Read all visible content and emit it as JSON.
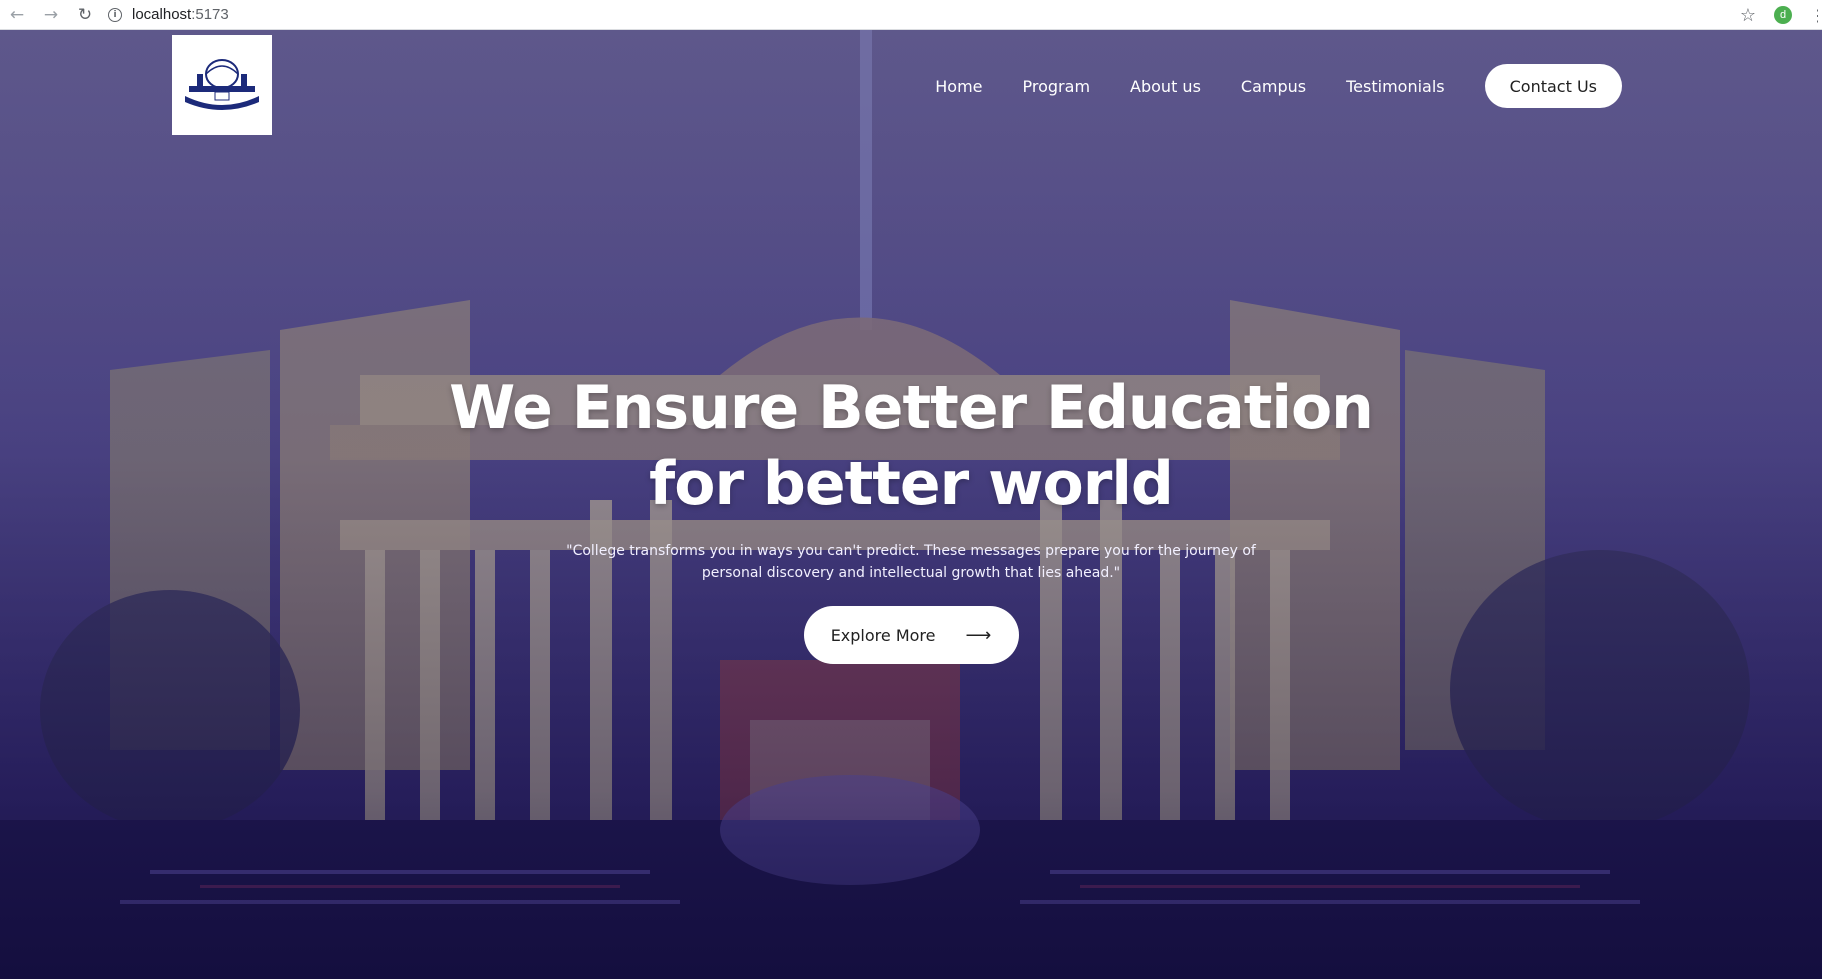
{
  "browser": {
    "url_host": "localhost",
    "url_port": ":5173",
    "profile_initial": "d",
    "icons": {
      "back": "back-arrow-icon",
      "forward": "forward-arrow-icon",
      "reload": "reload-icon",
      "info": "info-icon",
      "star": "star-icon",
      "menu": "menu-icon"
    }
  },
  "navbar": {
    "logo_alt": "College logo",
    "links": [
      "Home",
      "Program",
      "About us",
      "Campus",
      "Testimonials"
    ],
    "contact_label": "Contact Us"
  },
  "hero": {
    "title_line1": "We Ensure Better Education",
    "title_line2": "for better world",
    "quote": "\"College transforms you in ways you can't predict. These messages prepare you for the journey of personal discovery and intellectual growth that lies ahead.\"",
    "cta_label": "Explore More",
    "cta_icon": "arrow-right-icon"
  },
  "colors": {
    "overlay": "#4b4490",
    "button_bg": "#ffffff",
    "text_light": "#ffffff"
  }
}
